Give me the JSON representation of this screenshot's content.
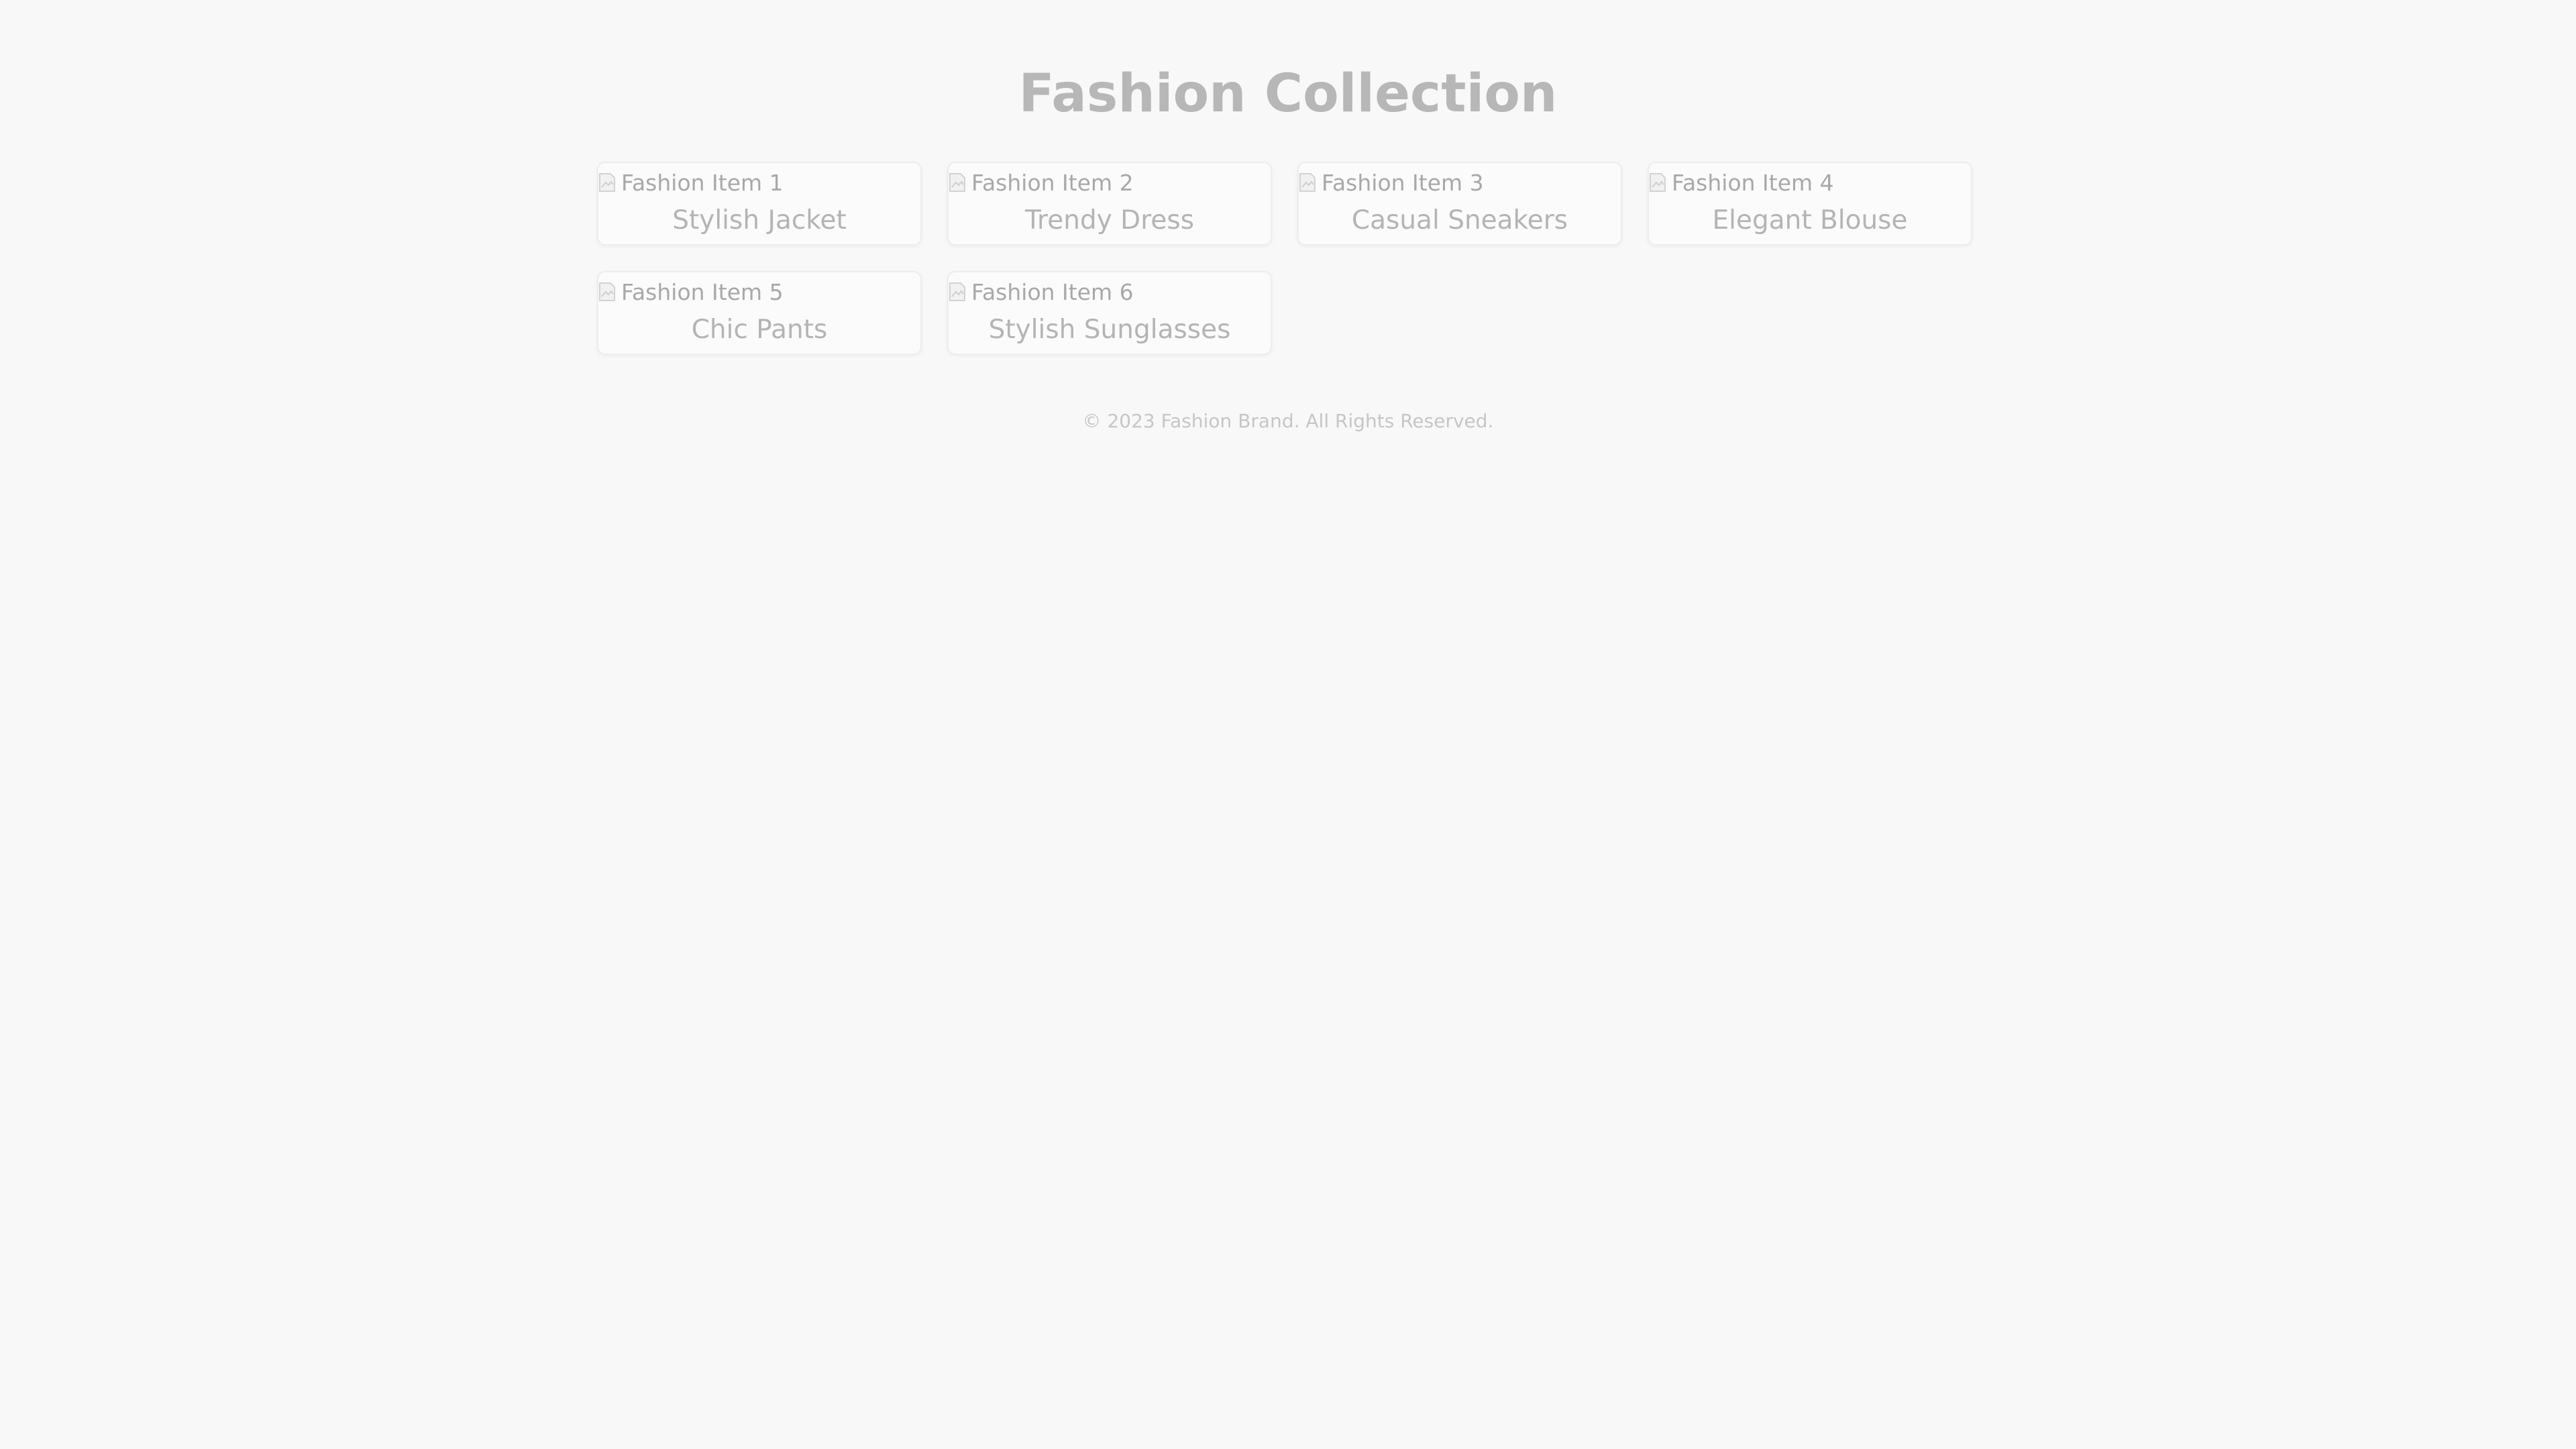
{
  "page": {
    "title": "Fashion Collection",
    "footer": "© 2023 Fashion Brand. All Rights Reserved."
  },
  "items": [
    {
      "image_alt": "Fashion Item 1",
      "name": "Stylish Jacket"
    },
    {
      "image_alt": "Fashion Item 2",
      "name": "Trendy Dress"
    },
    {
      "image_alt": "Fashion Item 3",
      "name": "Casual Sneakers"
    },
    {
      "image_alt": "Fashion Item 4",
      "name": "Elegant Blouse"
    },
    {
      "image_alt": "Fashion Item 5",
      "name": "Chic Pants"
    },
    {
      "image_alt": "Fashion Item 6",
      "name": "Stylish Sunglasses"
    }
  ],
  "colors": {
    "background": "#f8f8f8",
    "title": "#b7b7b7",
    "card_border": "#ededed",
    "text": "#b4b4b4"
  },
  "icons": {
    "image_placeholder": "broken-image-icon"
  }
}
